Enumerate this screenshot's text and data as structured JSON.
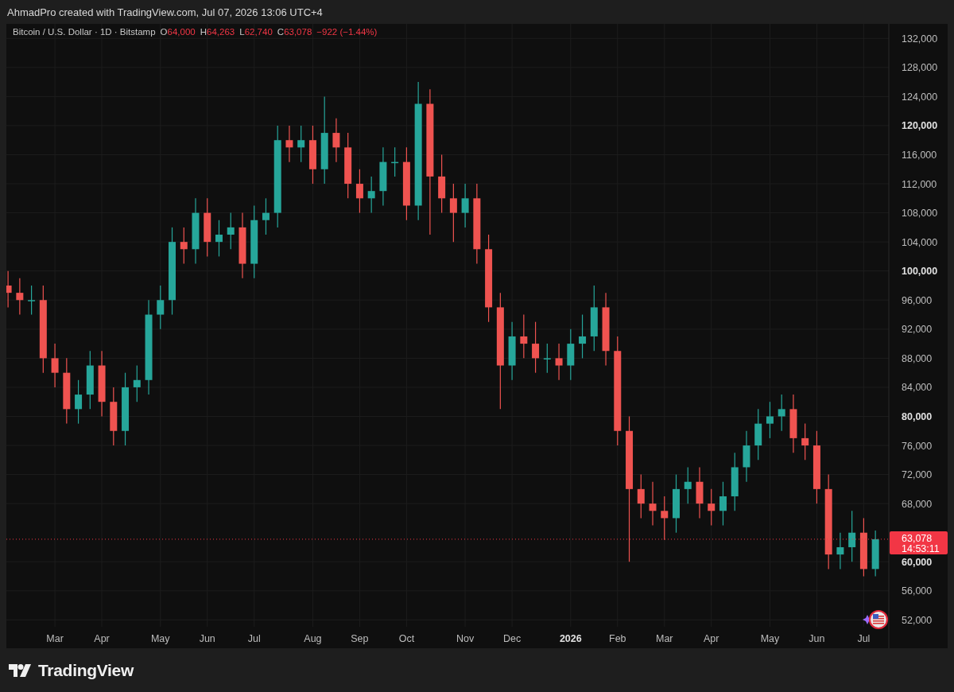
{
  "header": {
    "caption": "AhmadPro created with TradingView.com, Jul 07, 2026 13:06 UTC+4"
  },
  "legend": {
    "symbol": "Bitcoin / U.S. Dollar · 1D · Bitstamp",
    "ohlc": [
      {
        "label": "O",
        "value": "64,000"
      },
      {
        "label": "H",
        "value": "64,263"
      },
      {
        "label": "L",
        "value": "62,740"
      },
      {
        "label": "C",
        "value": "63,078"
      }
    ],
    "change": "−922 (−1.44%)"
  },
  "chart": {
    "last_price": {
      "value": "63,078",
      "countdown": "14:53:11"
    },
    "chart_data": {
      "type": "candlestick",
      "ylim": [
        48100,
        134000
      ],
      "grid": true,
      "ref_lines": [
        {
          "axis": "y",
          "value": 63100,
          "color": "#f23645"
        }
      ],
      "categories": [
        null,
        null,
        null,
        null,
        "Mar",
        null,
        null,
        null,
        "Apr",
        null,
        null,
        null,
        null,
        "May",
        null,
        null,
        null,
        "Jun",
        null,
        null,
        null,
        "Jul",
        null,
        null,
        null,
        null,
        "Aug",
        null,
        null,
        null,
        "Sep",
        null,
        null,
        null,
        "Oct",
        null,
        null,
        null,
        null,
        "Nov",
        null,
        null,
        null,
        "Dec",
        null,
        null,
        null,
        null,
        "2026",
        null,
        null,
        null,
        "Feb",
        null,
        null,
        null,
        "Mar",
        null,
        null,
        null,
        "Apr",
        null,
        null,
        null,
        null,
        "May",
        null,
        null,
        null,
        "Jun",
        null,
        null,
        null,
        "Jul",
        null
      ],
      "ohlc": [
        [
          98000,
          100000,
          95000,
          97000
        ],
        [
          97000,
          99000,
          94000,
          96000
        ],
        [
          96000,
          98000,
          94000,
          96000
        ],
        [
          96000,
          98000,
          86000,
          88000
        ],
        [
          88000,
          90000,
          84000,
          86000
        ],
        [
          86000,
          88000,
          79000,
          81000
        ],
        [
          81000,
          85000,
          79000,
          83000
        ],
        [
          83000,
          89000,
          81000,
          87000
        ],
        [
          87000,
          89000,
          80000,
          82000
        ],
        [
          82000,
          84000,
          76000,
          78000
        ],
        [
          78000,
          86000,
          76000,
          84000
        ],
        [
          84000,
          87000,
          82000,
          85000
        ],
        [
          85000,
          96000,
          83000,
          94000
        ],
        [
          94000,
          98000,
          92000,
          96000
        ],
        [
          96000,
          106000,
          94000,
          104000
        ],
        [
          104000,
          106000,
          101000,
          103000
        ],
        [
          103000,
          110000,
          101000,
          108000
        ],
        [
          108000,
          110000,
          102000,
          104000
        ],
        [
          104000,
          107000,
          102000,
          105000
        ],
        [
          105000,
          108000,
          103000,
          106000
        ],
        [
          106000,
          108000,
          99000,
          101000
        ],
        [
          101000,
          109000,
          99000,
          107000
        ],
        [
          107000,
          110000,
          105000,
          108000
        ],
        [
          108000,
          120000,
          106000,
          118000
        ],
        [
          118000,
          120000,
          115000,
          117000
        ],
        [
          117000,
          120000,
          115000,
          118000
        ],
        [
          118000,
          120000,
          112000,
          114000
        ],
        [
          114000,
          124000,
          112000,
          119000
        ],
        [
          119000,
          121000,
          115000,
          117000
        ],
        [
          117000,
          119000,
          110000,
          112000
        ],
        [
          112000,
          114000,
          108000,
          110000
        ],
        [
          110000,
          113000,
          108000,
          111000
        ],
        [
          111000,
          117000,
          109000,
          115000
        ],
        [
          115000,
          117000,
          113000,
          115000
        ],
        [
          115000,
          117000,
          107000,
          109000
        ],
        [
          109000,
          126000,
          107000,
          123000
        ],
        [
          123000,
          125000,
          105000,
          113000
        ],
        [
          113000,
          116000,
          108000,
          110000
        ],
        [
          110000,
          112000,
          104000,
          108000
        ],
        [
          108000,
          112000,
          106000,
          110000
        ],
        [
          110000,
          112000,
          101000,
          103000
        ],
        [
          103000,
          105000,
          93000,
          95000
        ],
        [
          95000,
          97000,
          81000,
          87000
        ],
        [
          87000,
          93000,
          85000,
          91000
        ],
        [
          91000,
          94000,
          88000,
          90000
        ],
        [
          90000,
          93000,
          86000,
          88000
        ],
        [
          88000,
          90000,
          86000,
          88000
        ],
        [
          88000,
          90000,
          85000,
          87000
        ],
        [
          87000,
          92000,
          85000,
          90000
        ],
        [
          90000,
          94000,
          88000,
          91000
        ],
        [
          91000,
          98000,
          89000,
          95000
        ],
        [
          95000,
          97000,
          87000,
          89000
        ],
        [
          89000,
          91000,
          76000,
          78000
        ],
        [
          78000,
          80000,
          60000,
          70000
        ],
        [
          70000,
          72000,
          66000,
          68000
        ],
        [
          68000,
          71000,
          65000,
          67000
        ],
        [
          67000,
          69000,
          63000,
          66000
        ],
        [
          66000,
          72000,
          64000,
          70000
        ],
        [
          70000,
          73000,
          68000,
          71000
        ],
        [
          71000,
          73000,
          66000,
          68000
        ],
        [
          68000,
          70000,
          65000,
          67000
        ],
        [
          67000,
          71000,
          65000,
          69000
        ],
        [
          69000,
          75000,
          67000,
          73000
        ],
        [
          73000,
          78000,
          71000,
          76000
        ],
        [
          76000,
          81000,
          74000,
          79000
        ],
        [
          79000,
          82000,
          77000,
          80000
        ],
        [
          80000,
          83000,
          78000,
          81000
        ],
        [
          81000,
          83000,
          75000,
          77000
        ],
        [
          77000,
          79000,
          74000,
          76000
        ],
        [
          76000,
          78000,
          68000,
          70000
        ],
        [
          70000,
          72000,
          59000,
          61000
        ],
        [
          61000,
          64000,
          59000,
          62000
        ],
        [
          62000,
          67000,
          60000,
          64000
        ],
        [
          64000,
          66000,
          58000,
          59000
        ],
        [
          59000,
          64300,
          58000,
          63100
        ]
      ],
      "yticks": [
        {
          "value": 132000,
          "label": "132,000"
        },
        {
          "value": 128000,
          "label": "128,000"
        },
        {
          "value": 124000,
          "label": "124,000"
        },
        {
          "value": 120000,
          "label": "120,000"
        },
        {
          "value": 116000,
          "label": "116,000"
        },
        {
          "value": 112000,
          "label": "112,000"
        },
        {
          "value": 108000,
          "label": "108,000"
        },
        {
          "value": 104000,
          "label": "104,000"
        },
        {
          "value": 100000,
          "label": "100,000"
        },
        {
          "value": 96000,
          "label": "96,000"
        },
        {
          "value": 92000,
          "label": "92,000"
        },
        {
          "value": 88000,
          "label": "88,000"
        },
        {
          "value": 84000,
          "label": "84,000"
        },
        {
          "value": 80000,
          "label": "80,000"
        },
        {
          "value": 76000,
          "label": "76,000"
        },
        {
          "value": 72000,
          "label": "72,000"
        },
        {
          "value": 68000,
          "label": "68,000"
        },
        {
          "value": 60000,
          "label": "60,000"
        },
        {
          "value": 56000,
          "label": "56,000"
        },
        {
          "value": 52000,
          "label": "52,000"
        }
      ]
    }
  },
  "footer": {
    "brand": "TradingView"
  }
}
